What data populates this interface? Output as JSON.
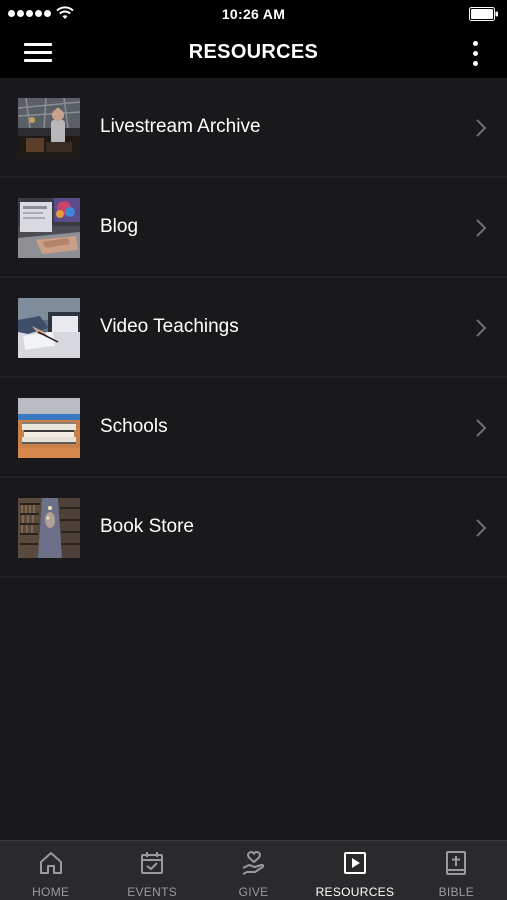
{
  "status_bar": {
    "time": "10:26 AM"
  },
  "header": {
    "title": "RESOURCES"
  },
  "resources": [
    {
      "label": "Livestream Archive",
      "thumb_icon": "livestream-thumbnail"
    },
    {
      "label": "Blog",
      "thumb_icon": "blog-thumbnail"
    },
    {
      "label": "Video Teachings",
      "thumb_icon": "video-teachings-thumbnail"
    },
    {
      "label": "Schools",
      "thumb_icon": "schools-thumbnail"
    },
    {
      "label": "Book Store",
      "thumb_icon": "book-store-thumbnail"
    }
  ],
  "tabs": [
    {
      "label": "HOME",
      "icon": "home-icon",
      "active": false
    },
    {
      "label": "EVENTS",
      "icon": "calendar-check-icon",
      "active": false
    },
    {
      "label": "GIVE",
      "icon": "hand-heart-icon",
      "active": false
    },
    {
      "label": "RESOURCES",
      "icon": "play-square-icon",
      "active": true
    },
    {
      "label": "BIBLE",
      "icon": "bible-icon",
      "active": false
    }
  ],
  "colors": {
    "background": "#19191b",
    "bar": "#000000",
    "tab_bar": "#2a2a2d",
    "tab_inactive": "#9a9a9e",
    "tab_active": "#ffffff"
  }
}
